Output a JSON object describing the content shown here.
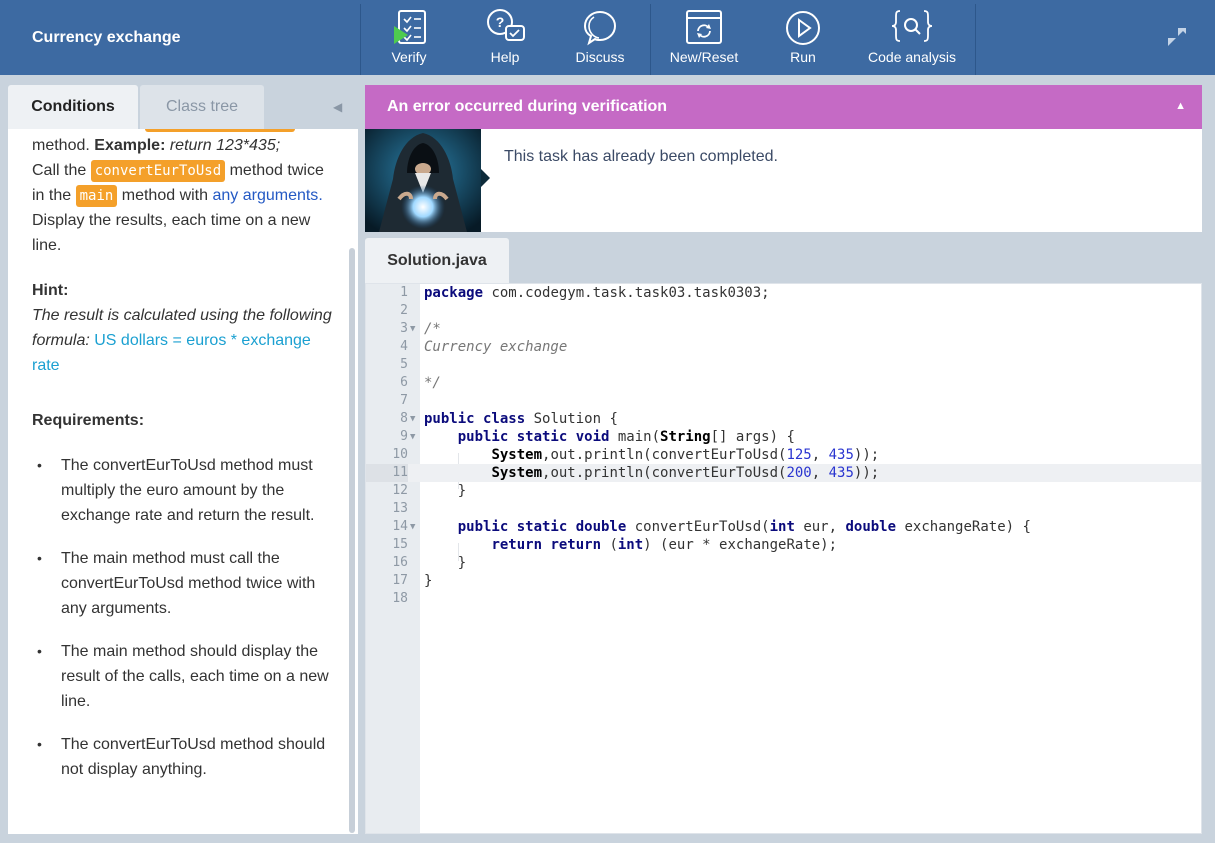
{
  "app": {
    "title": "Currency exchange"
  },
  "toolbar": {
    "verify": "Verify",
    "help": "Help",
    "discuss": "Discuss",
    "new_reset": "New/Reset",
    "run": "Run",
    "code_analysis": "Code analysis"
  },
  "left": {
    "tabs": {
      "conditions": "Conditions",
      "class_tree": "Class tree"
    },
    "para1": {
      "t1": "method. ",
      "example_label": "Example:",
      "example_code": " return 123*435;",
      "t2": "Call the ",
      "chip1": "convertEurToUsd",
      "t3": " method twice in the ",
      "chip2": "main",
      "t4": " method with ",
      "link": "any arguments",
      "t5": ".",
      "t6": "Display the results, each time on a new line."
    },
    "hint": {
      "heading": "Hint:",
      "text": "The result is calculated using the following formula: ",
      "formula": "US dollars = euros * exchange rate"
    },
    "requirements": {
      "heading": "Requirements:",
      "items": [
        "The convertEurToUsd method must multiply the euro amount by the exchange rate and return the result.",
        "The main method must call the convertEurToUsd method twice with any arguments.",
        "The main method should display the result of the calls, each time on a new line.",
        "The convertEurToUsd method should not display anything."
      ]
    }
  },
  "error": {
    "title": "An error occurred during verification",
    "message": "This task has already been completed."
  },
  "editor": {
    "file_tab": "Solution.java",
    "line_numbers": [
      "1",
      "2",
      "3",
      "4",
      "5",
      "6",
      "7",
      "8",
      "9",
      "10",
      "11",
      "12",
      "13",
      "14",
      "15",
      "16",
      "17",
      "18"
    ],
    "code": {
      "l1_kw": "package",
      "l1_rest": " com.codegym.task.task03.task0303;",
      "l3": "/*",
      "l4": "Currency exchange",
      "l6": "*/",
      "l8_kw": "public class",
      "l8_rest": " Solution {",
      "l9_kw": "public static void",
      "l9_mid": " main(",
      "l9_ty": "String",
      "l9_rest": "[] args) {",
      "l10_sys": "System",
      "l10_mid": ",out.println(convertEurToUsd(",
      "l10_n1": "125",
      "l10_sep": ", ",
      "l10_n2": "435",
      "l10_end": "));",
      "l11_sys": "System",
      "l11_mid": ",out.println(convertEurToUsd(",
      "l11_n1": "200",
      "l11_sep": ", ",
      "l11_n2": "435",
      "l11_end": "));",
      "l12": "}",
      "l14_kw1": "public static double",
      "l14_mid1": " convertEurToUsd(",
      "l14_kw2": "int",
      "l14_mid2": " eur, ",
      "l14_kw3": "double",
      "l14_end": " exchangeRate) {",
      "l15_kw": "return return",
      "l15_mid": " (",
      "l15_kw2": "int",
      "l15_end": ") (eur * exchangeRate);",
      "l16": "}",
      "l17": "}"
    }
  }
}
